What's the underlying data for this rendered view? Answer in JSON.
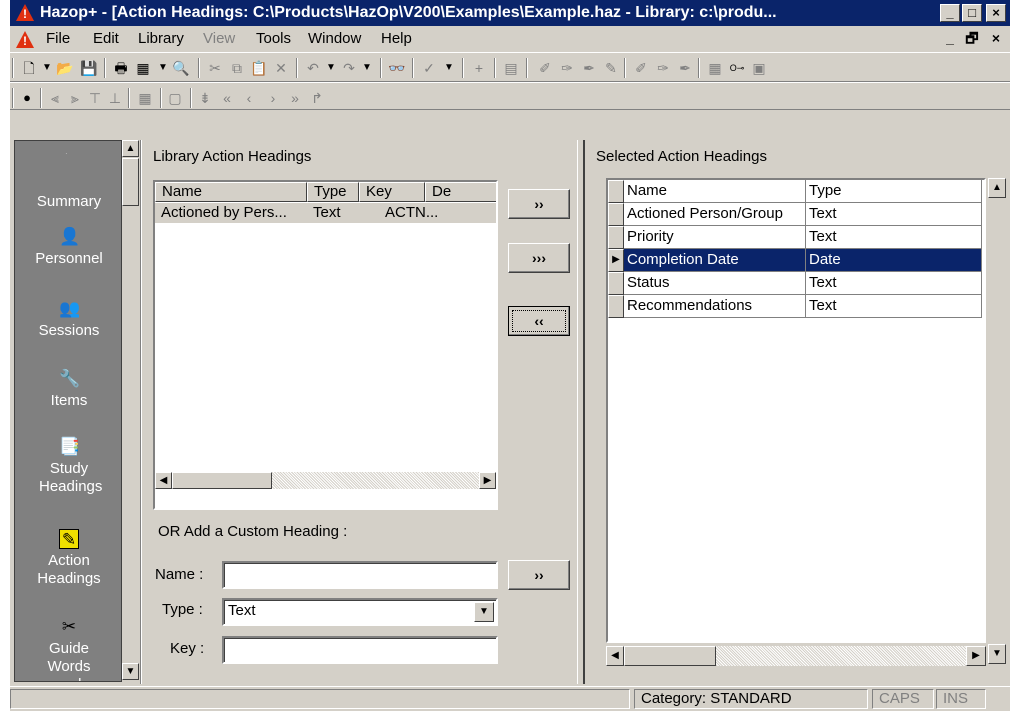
{
  "window": {
    "title": "Hazop+ - [Action Headings: C:\\Products\\HazOp\\V200\\Examples\\Example.haz - Library: c:\\produ...",
    "caption_minimize": "_",
    "caption_maximize": "□",
    "caption_close": "×"
  },
  "menu": {
    "items": [
      "File",
      "Edit",
      "Library",
      "View",
      "Tools",
      "Window",
      "Help"
    ],
    "mdi_min": "_",
    "mdi_restore": "🗗",
    "mdi_close": "×"
  },
  "sidebar": {
    "items": [
      {
        "label": "Summary",
        "icon": "summary-icon"
      },
      {
        "label": "Personnel",
        "icon": "personnel-icon"
      },
      {
        "label": "Sessions",
        "icon": "sessions-icon"
      },
      {
        "label": "Items",
        "icon": "items-icon"
      },
      {
        "label": "Study Headings",
        "icon": "study-headings-icon"
      },
      {
        "label": "Action Headings",
        "icon": "action-headings-icon"
      },
      {
        "label": "Guide Words and",
        "icon": "guide-words-icon"
      }
    ]
  },
  "library": {
    "title": "Library Action Headings",
    "columns": [
      "Name",
      "Type",
      "Key",
      "De"
    ],
    "rows": [
      {
        "name": "Actioned by Pers...",
        "type": "Text",
        "key": "ACTN..."
      }
    ]
  },
  "buttons": {
    "add_one": "››",
    "add_all": "›››",
    "remove": "‹‹",
    "add_custom": "››"
  },
  "custom": {
    "title": "OR Add a Custom Heading :",
    "name_label": "Name :",
    "name_value": "",
    "type_label": "Type :",
    "type_value": "Text",
    "key_label": "Key :",
    "key_value": ""
  },
  "selected": {
    "title": "Selected Action Headings",
    "columns": [
      "Name",
      "Type"
    ],
    "rows": [
      {
        "name": "Actioned Person/Group",
        "type": "Text",
        "selected": false
      },
      {
        "name": "Priority",
        "type": "Text",
        "selected": false
      },
      {
        "name": "Completion Date",
        "type": "Date",
        "selected": true
      },
      {
        "name": "Status",
        "type": "Text",
        "selected": false
      },
      {
        "name": "Recommendations",
        "type": "Text",
        "selected": false
      }
    ]
  },
  "status": {
    "category": "Category: STANDARD",
    "caps": "CAPS",
    "ins": "INS"
  },
  "colors": {
    "title_bar": "#0a246a",
    "selection": "#0a246a",
    "sidebar": "#808080",
    "face": "#d4d0c8"
  }
}
